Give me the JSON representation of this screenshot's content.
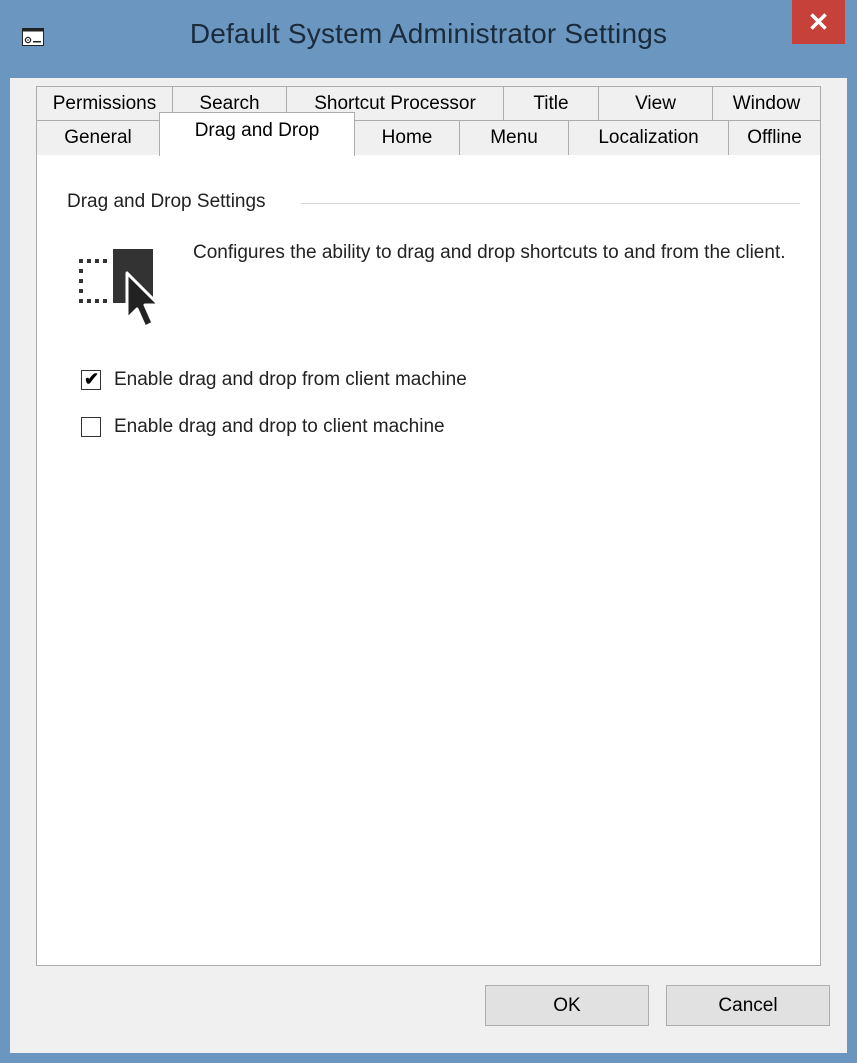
{
  "window": {
    "title": "Default System Administrator Settings",
    "close_glyph": "✕"
  },
  "tabs": {
    "row1": [
      {
        "label": "Permissions"
      },
      {
        "label": "Search"
      },
      {
        "label": "Shortcut Processor"
      },
      {
        "label": "Title"
      },
      {
        "label": "View"
      },
      {
        "label": "Window"
      }
    ],
    "row2": [
      {
        "label": "General"
      },
      {
        "label": "Drag and Drop",
        "selected": true
      },
      {
        "label": "Home"
      },
      {
        "label": "Menu"
      },
      {
        "label": "Localization"
      },
      {
        "label": "Offline"
      }
    ]
  },
  "panel": {
    "group_title": "Drag and Drop Settings",
    "icon": "drag-drop-icon",
    "description": "Configures the ability to drag and drop shortcuts to and from the client.",
    "options": [
      {
        "label": "Enable drag and drop from client machine",
        "checked": true,
        "mark": "✔"
      },
      {
        "label": "Enable drag and drop to client machine",
        "checked": false,
        "mark": ""
      }
    ]
  },
  "buttons": {
    "ok": "OK",
    "cancel": "Cancel"
  },
  "colors": {
    "frame": "#6b96bf",
    "close": "#c7413b",
    "face": "#f0f0f0"
  }
}
